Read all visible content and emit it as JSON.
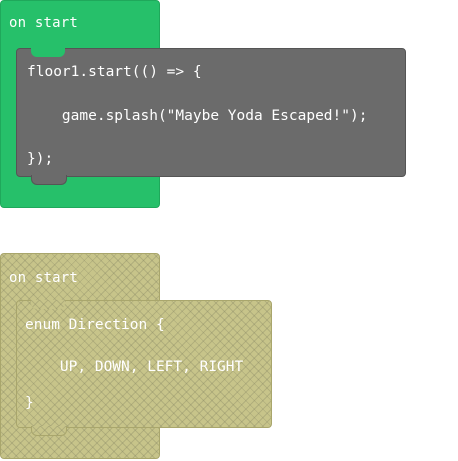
{
  "blocks": [
    {
      "hat_label": "on start",
      "code_lines": [
        "floor1.start(() => {",
        "    game.splash(\"Maybe Yoda Escaped!\");",
        "});"
      ],
      "hat_color": "#26c06a",
      "code_color": "#6b6b6b"
    },
    {
      "hat_label": "on start",
      "code_lines": [
        "enum Direction {",
        "    UP, DOWN, LEFT, RIGHT",
        "}"
      ],
      "hat_color": "#c7c48a",
      "code_color": "#c7c48a",
      "pattern": "diagonal-crosshatch"
    }
  ]
}
